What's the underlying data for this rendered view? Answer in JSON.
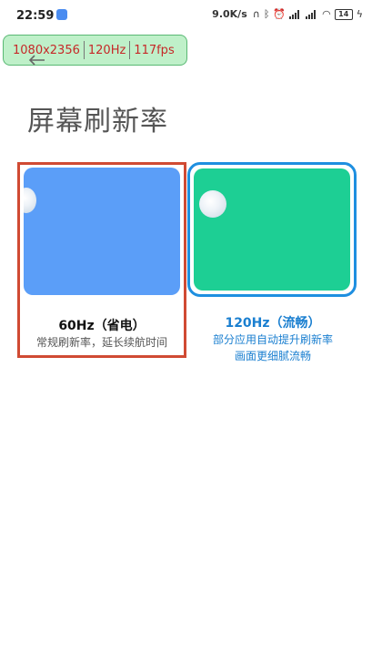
{
  "status_bar": {
    "time": "22:59",
    "net_speed": "9.0K/s",
    "battery": "14"
  },
  "overlay": {
    "resolution": "1080x2356",
    "refresh": "120Hz",
    "fps": "117fps"
  },
  "page": {
    "title": "屏幕刷新率"
  },
  "options": [
    {
      "title": "60Hz（省电）",
      "desc": [
        "常规刷新率，延长续航时间"
      ],
      "selected": false,
      "color": "#5b9ef8"
    },
    {
      "title": "120Hz（流畅）",
      "desc": [
        "部分应用自动提升刷新率",
        "画面更细腻流畅"
      ],
      "selected": true,
      "color": "#1dcf94"
    }
  ],
  "colors": {
    "accent": "#1a7fd0",
    "highlight_box": "#d04a33",
    "overlay_text": "#c62828"
  }
}
